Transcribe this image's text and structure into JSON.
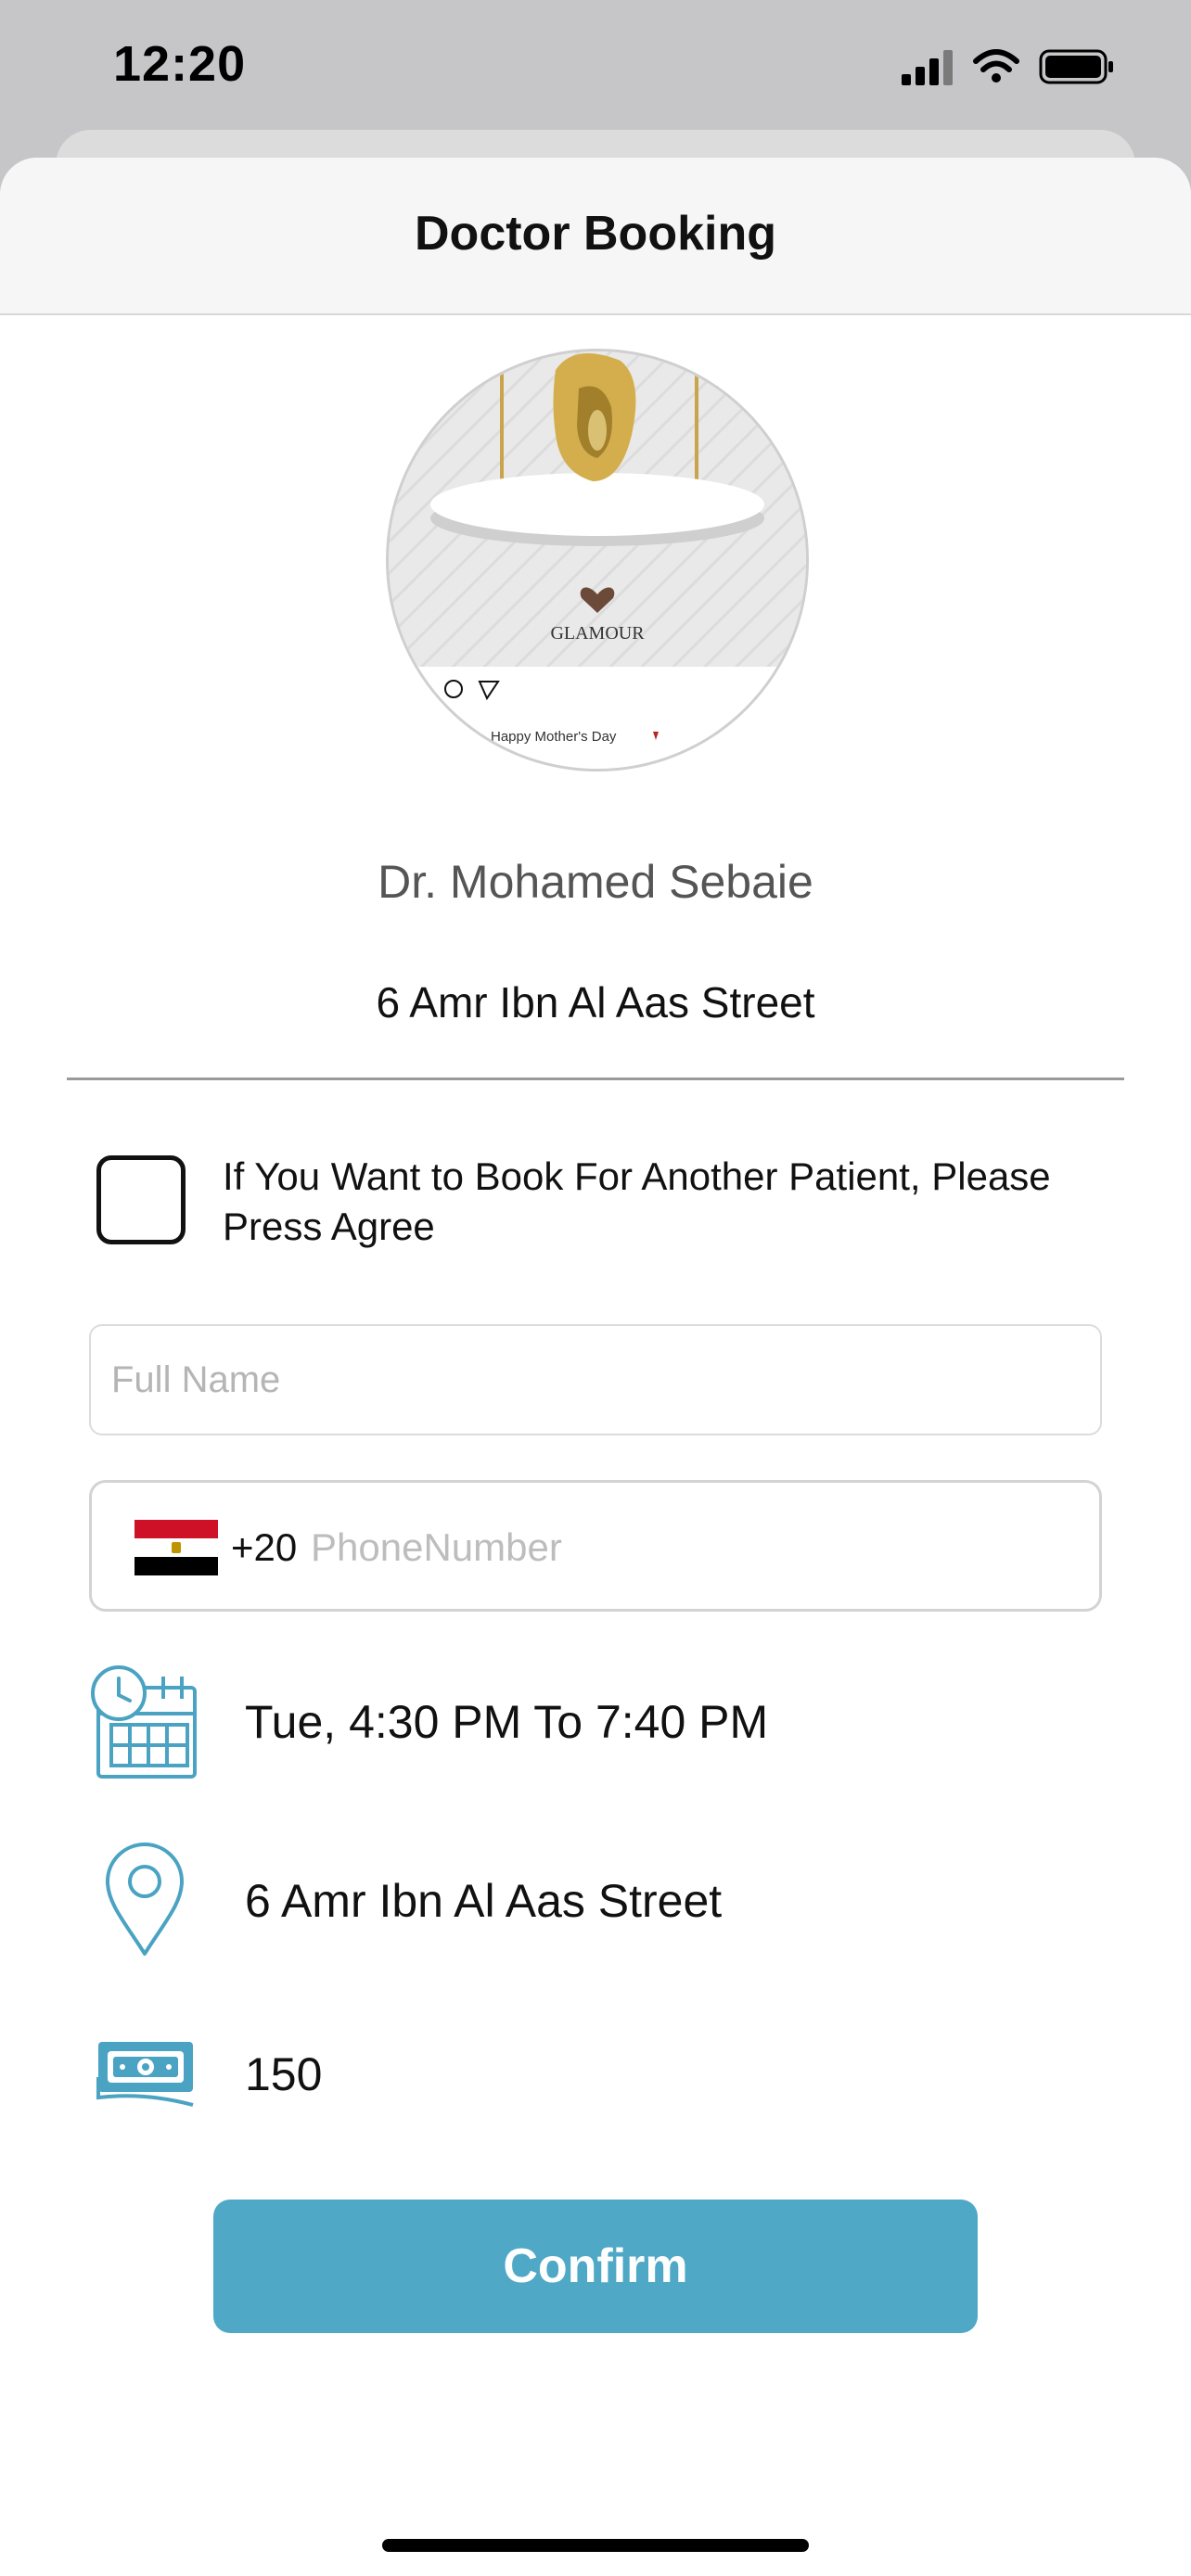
{
  "status_bar": {
    "time": "12:20"
  },
  "nav": {
    "title": "Doctor Booking"
  },
  "avatar": {
    "brand": "GLAMOUR",
    "caption": "Happy Mother's Day"
  },
  "doctor": {
    "name": "Dr. Mohamed Sebaie",
    "address": "6 Amr Ibn Al Aas Street"
  },
  "agree": {
    "text": "If You Want to Book For Another Patient, Please Press Agree",
    "checked": false
  },
  "form": {
    "full_name_placeholder": "Full Name",
    "dial_code": "+20",
    "phone_placeholder": "PhoneNumber",
    "country_icon": "egypt-flag-icon"
  },
  "details": {
    "schedule": "Tue, 4:30 PM To 7:40 PM",
    "location": "6 Amr Ibn Al Aas Street",
    "fee": "150"
  },
  "confirm_label": "Confirm",
  "colors": {
    "accent": "#4ea8c6",
    "icon": "#4aa3c2",
    "flag_red": "#ce1126",
    "flag_white": "#ffffff",
    "flag_black": "#000000"
  }
}
